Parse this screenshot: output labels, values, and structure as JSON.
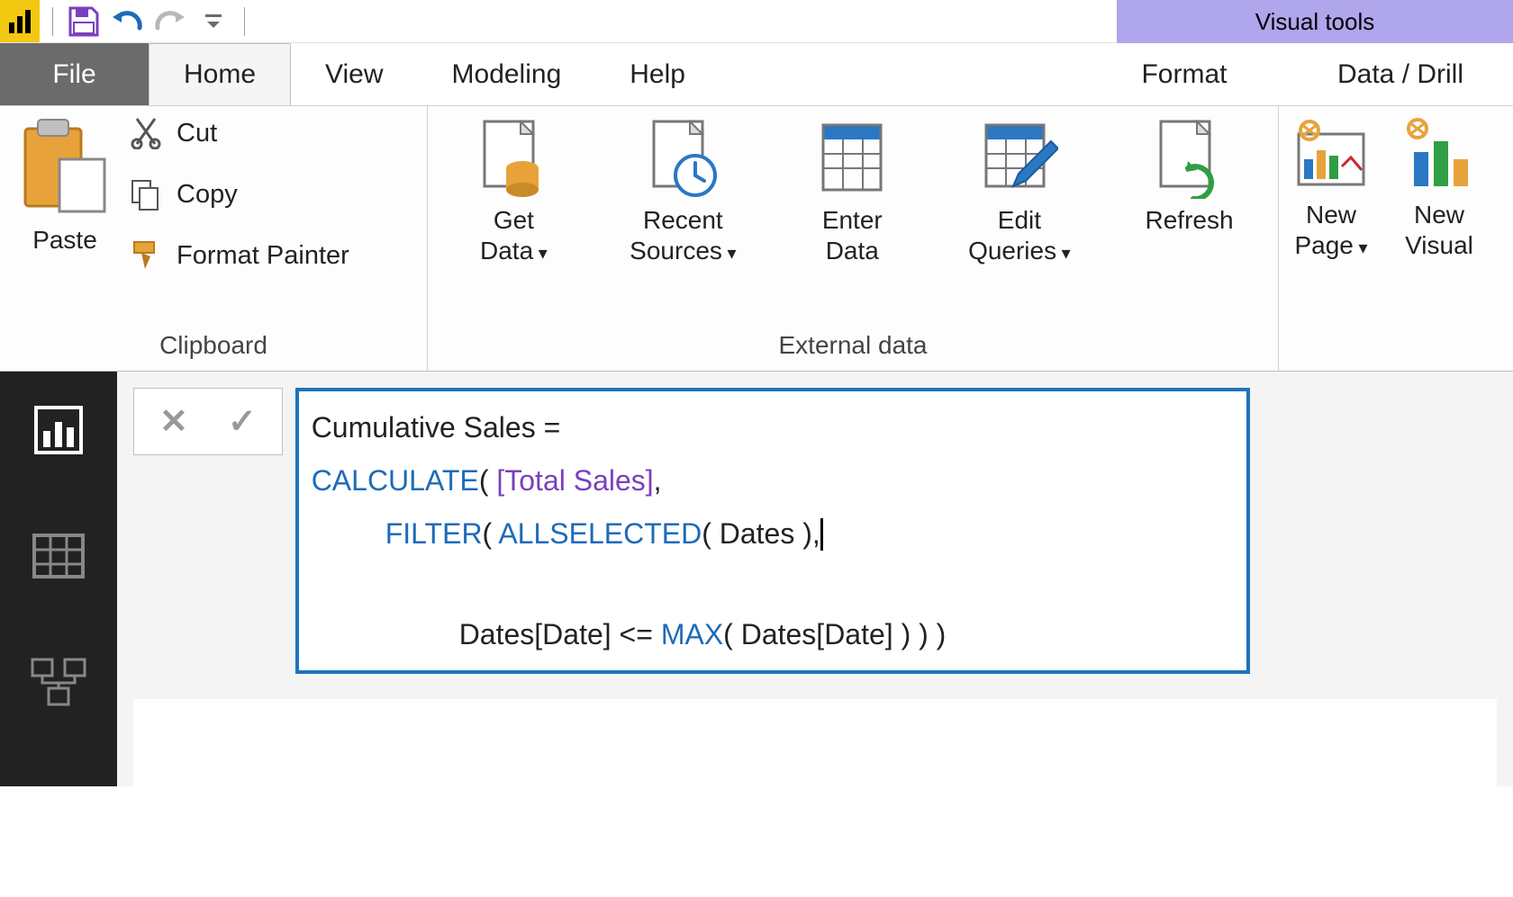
{
  "quick_access": {
    "save": "Save",
    "undo": "Undo",
    "redo": "Redo",
    "customize": "Customize Quick Access Toolbar"
  },
  "context_tab_group_label": "Visual tools",
  "tabs": {
    "file": "File",
    "home": "Home",
    "view": "View",
    "modeling": "Modeling",
    "help": "Help",
    "format": "Format",
    "datadrill": "Data / Drill"
  },
  "ribbon": {
    "clipboard": {
      "group_label": "Clipboard",
      "paste": "Paste",
      "cut": "Cut",
      "copy": "Copy",
      "format_painter": "Format Painter"
    },
    "external_data": {
      "group_label": "External data",
      "get_data_l1": "Get",
      "get_data_l2": "Data",
      "recent_l1": "Recent",
      "recent_l2": "Sources",
      "enter_l1": "Enter",
      "enter_l2": "Data",
      "edit_l1": "Edit",
      "edit_l2": "Queries",
      "refresh": "Refresh"
    },
    "insert": {
      "new_page_l1": "New",
      "new_page_l2": "Page",
      "new_visual_l1": "New",
      "new_visual_l2": "Visual"
    }
  },
  "nav": {
    "report": "Report view",
    "data": "Data view",
    "model": "Model view"
  },
  "formula_bar": {
    "cancel": "Cancel",
    "commit": "Commit"
  },
  "formula": {
    "line1_plain": "Cumulative Sales = ",
    "calculate": "CALCULATE",
    "l2_a": "( ",
    "total_sales": "[Total Sales]",
    "l2_b": ",",
    "filter": "FILTER",
    "l3_a": "( ",
    "allselected": "ALLSELECTED",
    "l3_b": "( Dates ),",
    "l4_a": "Dates[Date] <= ",
    "max": "MAX",
    "l4_b": "( Dates[Date] ) ) )"
  }
}
